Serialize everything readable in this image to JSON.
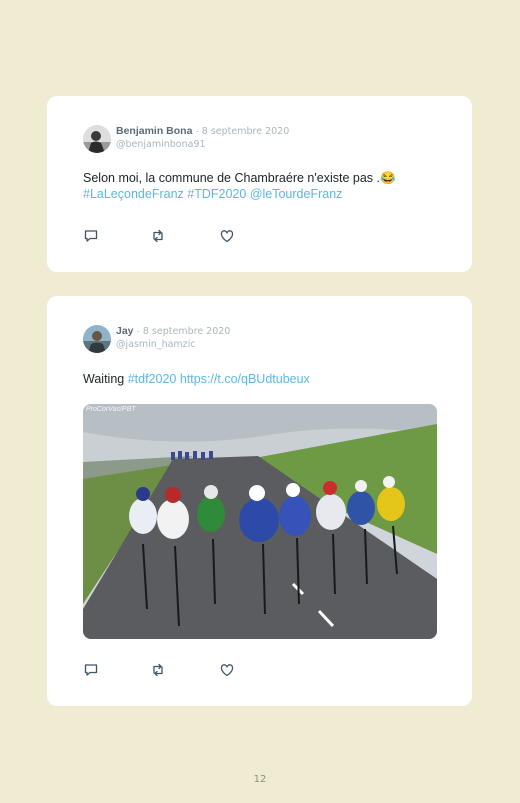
{
  "tweets": [
    {
      "name": "Benjamin Bona",
      "date": "8 septembre 2020",
      "handle": "@benjaminbona91",
      "text": "Selon moi, la commune de Chambraére n'existe pas .😂",
      "hashtags": [
        "#LaLeçondeFranz",
        "#TDF2020",
        "@leTourdeFranz"
      ]
    },
    {
      "name": "Jay",
      "date": "8 septembre 2020",
      "handle": "@jasmin_hamzic",
      "text_prefix": "Waiting",
      "hashtag": "#tdf2020",
      "link": "https://t.co/qBUdtubeux",
      "photo_watermark": "ProCorVas/PBT"
    }
  ],
  "icons": {
    "reply": "reply-icon",
    "retweet": "retweet-icon",
    "like": "heart-icon"
  },
  "colors": {
    "background": "#efecd2",
    "card": "#ffffff",
    "link": "#5cb8e6",
    "muted": "#aab6be",
    "name": "#5b6b76"
  },
  "page_number": "12"
}
